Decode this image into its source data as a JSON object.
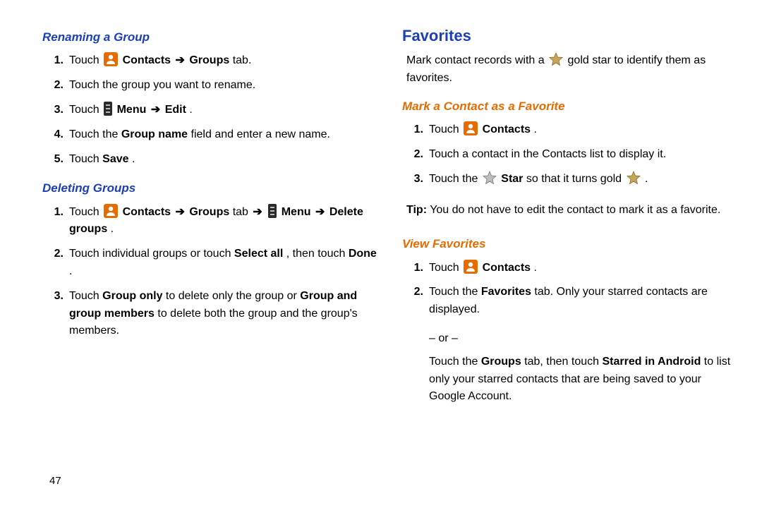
{
  "page_number": "47",
  "left": {
    "renaming_heading": "Renaming a Group",
    "r1_a": "Touch ",
    "r1_b": "Contacts",
    "r1_c": "Groups",
    "r1_d": " tab.",
    "r2": "Touch the group you want to rename.",
    "r3_a": "Touch ",
    "r3_b": "Menu",
    "r3_c": "Edit",
    "r3_d": ".",
    "r4_a": "Touch the ",
    "r4_b": "Group name",
    "r4_c": " field and enter a new name.",
    "r5_a": "Touch ",
    "r5_b": "Save",
    "r5_c": ".",
    "deleting_heading": "Deleting Groups",
    "d1_a": "Touch ",
    "d1_b": "Contacts",
    "d1_c": "Groups",
    "d1_d": " tab",
    "d1_e": "Menu",
    "d1_f": "Delete groups",
    "d1_g": ".",
    "d2_a": "Touch individual groups or touch ",
    "d2_b": "Select all",
    "d2_c": ", then touch ",
    "d2_d": "Done",
    "d2_e": ".",
    "d3_a": "Touch ",
    "d3_b": "Group only",
    "d3_c": " to delete only the group or ",
    "d3_d": "Group and group members",
    "d3_e": " to delete both the group and the group's members."
  },
  "right": {
    "fav_heading": "Favorites",
    "intro_a": "Mark contact records with a ",
    "intro_b": " gold star to identify them as favorites.",
    "mark_heading": "Mark a Contact as a Favorite",
    "m1_a": "Touch ",
    "m1_b": "Contacts",
    "m1_c": ".",
    "m2": "Touch a contact in the Contacts list to display it.",
    "m3_a": "Touch the ",
    "m3_b": "Star",
    "m3_c": " so that it turns gold ",
    "m3_d": ".",
    "tip_a": "Tip:",
    "tip_b": " You do not have to edit the contact to mark it as a favorite.",
    "view_heading": "View Favorites",
    "v1_a": "Touch ",
    "v1_b": "Contacts",
    "v1_c": ".",
    "v2_a": "Touch the ",
    "v2_b": "Favorites",
    "v2_c": " tab. Only your starred contacts are displayed.",
    "or": "– or –",
    "v3_a": "Touch the ",
    "v3_b": "Groups",
    "v3_c": " tab, then touch ",
    "v3_d": "Starred in Android",
    "v3_e": " to list only your starred contacts that are being saved to your Google Account."
  },
  "arrow": "➔",
  "nums": {
    "1": "1.",
    "2": "2.",
    "3": "3.",
    "4": "4.",
    "5": "5."
  }
}
